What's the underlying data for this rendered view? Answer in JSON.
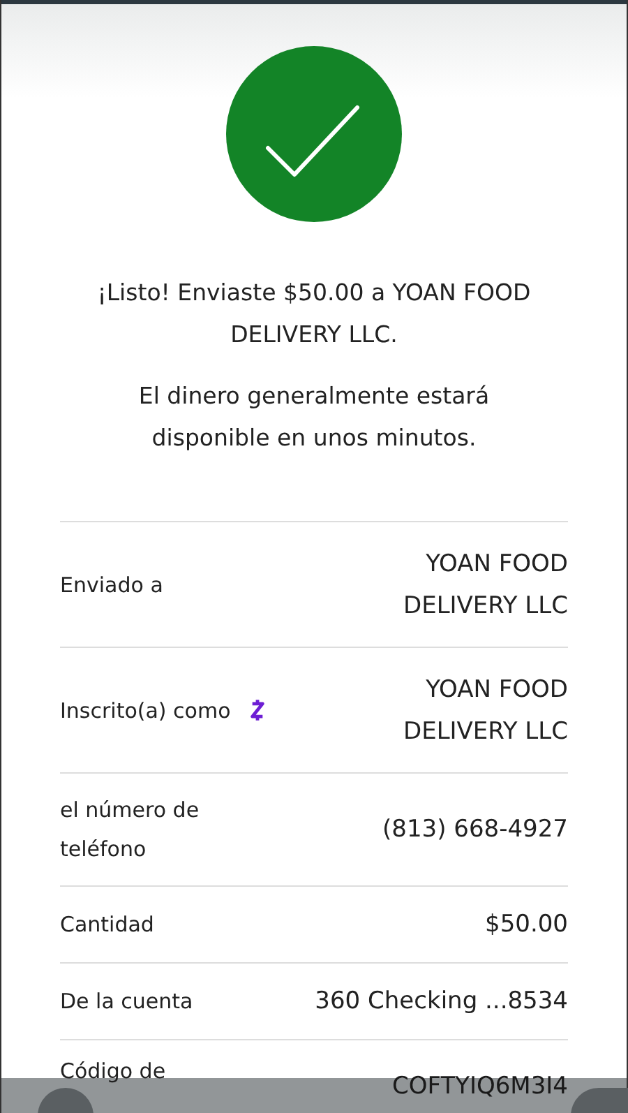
{
  "status": {
    "kind": "success"
  },
  "message": "¡Listo! Enviaste $50.00 a YOAN FOOD DELIVERY LLC.",
  "note": "El dinero generalmente estará disponible en unos minutos.",
  "details": [
    {
      "kind": "plain",
      "label": "Enviado a",
      "value": "YOAN FOOD DELIVERY LLC"
    },
    {
      "kind": "enrolled",
      "label": "Inscrito(a) como",
      "value": "YOAN FOOD DELIVERY LLC"
    },
    {
      "kind": "plain",
      "label": "el número de teléfono",
      "value": "(813) 668-4927"
    },
    {
      "kind": "plain",
      "label": "Cantidad",
      "value": "$50.00"
    },
    {
      "kind": "plain",
      "label": "De la cuenta",
      "value": "360 Checking ...8534"
    },
    {
      "kind": "plain",
      "label": "Código de",
      "value": "COFTYIQ6M3I4"
    }
  ]
}
